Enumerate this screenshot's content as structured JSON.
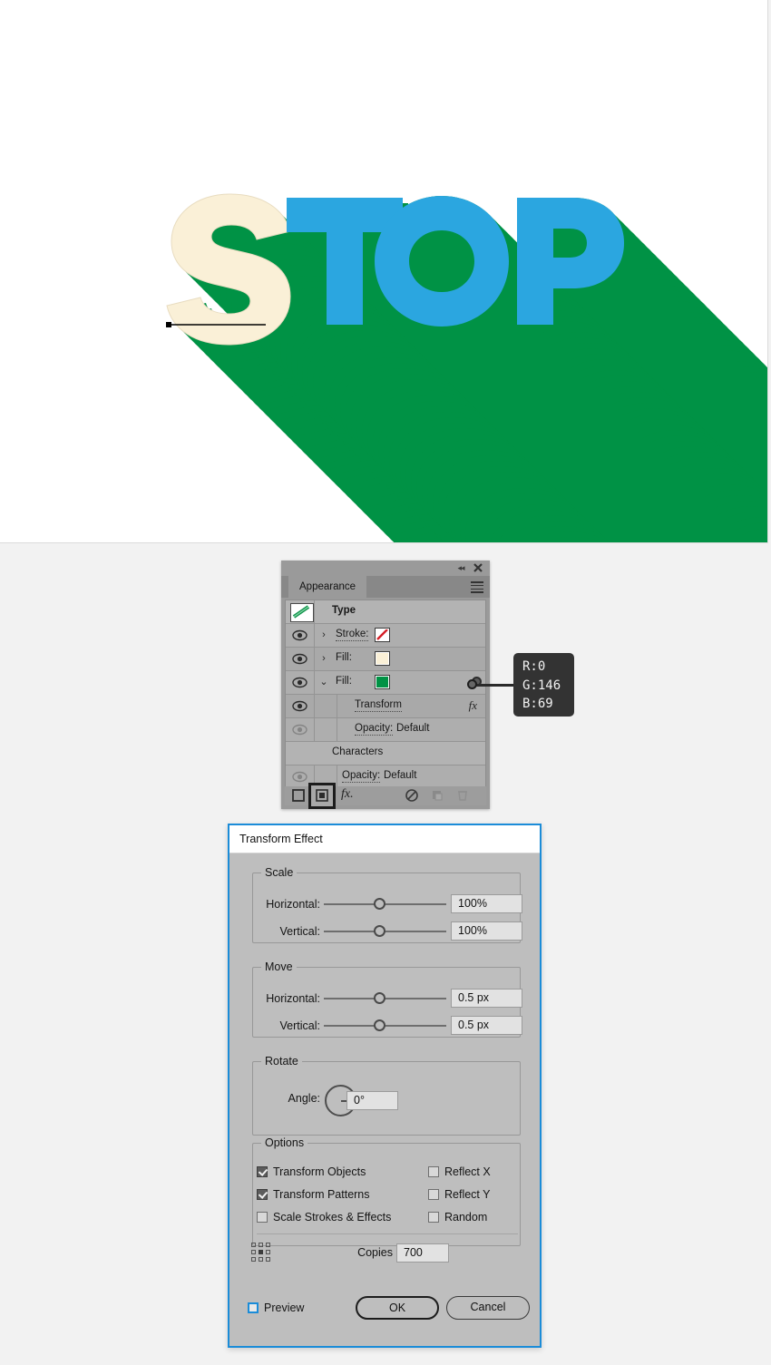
{
  "artwork": {
    "text": "STOP",
    "letter_s_color": "#faf0d7",
    "letters_top_color": "#2ba6e0",
    "shadow_color": "#009245",
    "shadow_rgb": "R:0 G:146 B:69",
    "background": "#ffffff"
  },
  "appearance_panel": {
    "tab_label": "Appearance",
    "collapse_icon": "double-chevron-left-icon",
    "close_icon": "close-icon",
    "menu_icon": "panel-menu-icon",
    "rows": [
      {
        "name": "type-row",
        "label": "Type",
        "value": "",
        "kind": "header",
        "thumb": "type-thumbnail"
      },
      {
        "name": "stroke-row",
        "label": "Stroke:",
        "value": "",
        "kind": "stroke",
        "swatch": "none"
      },
      {
        "name": "fill-cream-row",
        "label": "Fill:",
        "value": "",
        "kind": "fill",
        "swatch": "#faf0d7"
      },
      {
        "name": "fill-green-row",
        "label": "Fill:",
        "value": "",
        "kind": "fill-open",
        "swatch": "#009245"
      },
      {
        "name": "transform-row",
        "label": "Transform",
        "value": "",
        "kind": "effect",
        "fx": "fx"
      },
      {
        "name": "opacity-row-1",
        "label": "Opacity:",
        "value": "Default",
        "kind": "opacity"
      },
      {
        "name": "characters-row",
        "label": "Characters",
        "value": "",
        "kind": "section"
      },
      {
        "name": "opacity-row-2",
        "label": "Opacity:",
        "value": "Default",
        "kind": "opacity"
      }
    ],
    "footer": {
      "add_new_stroke": "add-new-stroke-icon",
      "add_new_fill": "add-new-fill-icon",
      "add_effect": "fx.",
      "clear_appearance": "clear-appearance-icon",
      "duplicate_item": "duplicate-item-icon",
      "delete_item": "delete-item-icon"
    }
  },
  "color_tooltip": {
    "r": "R:0",
    "g": "G:146",
    "b": "B:69"
  },
  "dialog": {
    "title": "Transform Effect",
    "scale": {
      "legend": "Scale",
      "horizontal_label": "Horizontal:",
      "horizontal_value": "100%",
      "vertical_label": "Vertical:",
      "vertical_value": "100%"
    },
    "move": {
      "legend": "Move",
      "horizontal_label": "Horizontal:",
      "horizontal_value": "0.5 px",
      "vertical_label": "Vertical:",
      "vertical_value": "0.5 px"
    },
    "rotate": {
      "legend": "Rotate",
      "angle_label": "Angle:",
      "angle_value": "0°"
    },
    "options": {
      "legend": "Options",
      "transform_objects": {
        "label": "Transform Objects",
        "checked": true
      },
      "transform_patterns": {
        "label": "Transform Patterns",
        "checked": true
      },
      "scale_strokes": {
        "label": "Scale Strokes & Effects",
        "checked": false
      },
      "reflect_x": {
        "label": "Reflect X",
        "checked": false
      },
      "reflect_y": {
        "label": "Reflect Y",
        "checked": false
      },
      "random": {
        "label": "Random",
        "checked": false
      },
      "copies_label": "Copies",
      "copies_value": "700",
      "reference_point_icon": "reference-point-grid-icon"
    },
    "footer": {
      "preview_label": "Preview",
      "preview_checked": false,
      "ok_label": "OK",
      "cancel_label": "Cancel"
    }
  }
}
